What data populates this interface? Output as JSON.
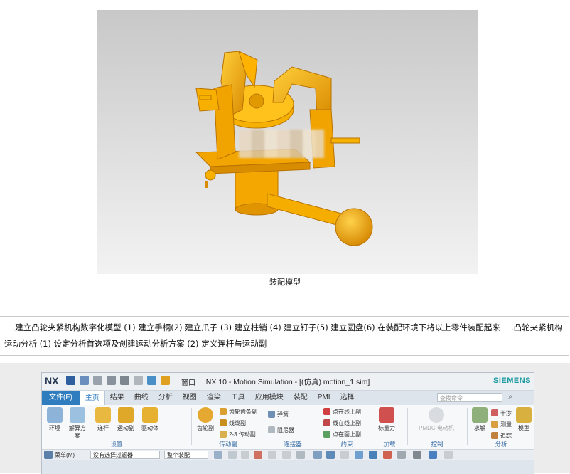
{
  "figure": {
    "caption": "装配模型"
  },
  "description": "一.建立凸轮夹紧机构数字化模型 (1) 建立手柄(2) 建立爪子 (3) 建立柱销 (4) 建立钉子(5) 建立圆盘(6) 在装配环境下将以上零件装配起来 二.凸轮夹紧机构运动分析 (1) 设定分析首选项及创建运动分析方案 (2) 定义连杆与运动副",
  "nx": {
    "logo": "NX",
    "window_menu": "窗口",
    "title": "NX 10 - Motion Simulation - [(仿真) motion_1.sim]",
    "brand": "SIEMENS",
    "file_tab": "文件(F)",
    "tabs": [
      "主页",
      "结果",
      "曲线",
      "分析",
      "视图",
      "渲染",
      "工具",
      "应用模块",
      "装配",
      "PMI",
      "选择"
    ],
    "search_placeholder": "查找命令",
    "groups": {
      "setup": {
        "label": "设置",
        "items": [
          "环境",
          "解算方案",
          "连杆",
          "运动副",
          "驱动体"
        ]
      },
      "coupler": {
        "label": "传动副",
        "items": [
          "齿轮副",
          "齿轮齿条副",
          "线缆副",
          "2-3 传动副"
        ]
      },
      "connector": {
        "label": "连接器",
        "items": [
          "弹簧",
          "阻尼器"
        ]
      },
      "constraint": {
        "label": "约束",
        "items": [
          "点在线上副",
          "线在线上副",
          "点在面上副"
        ]
      },
      "load": {
        "label": "加载",
        "items": [
          "标量力"
        ]
      },
      "control": {
        "label": "控制",
        "items": [
          "PMDC 电动机"
        ]
      },
      "analysis": {
        "label": "分析",
        "items": [
          "求解",
          "干涉",
          "测量",
          "追踪",
          "模型"
        ]
      }
    },
    "bottom": {
      "menu_label": "菜单(M)",
      "filter": "没有选择过滤器",
      "scope": "整个装配"
    }
  }
}
